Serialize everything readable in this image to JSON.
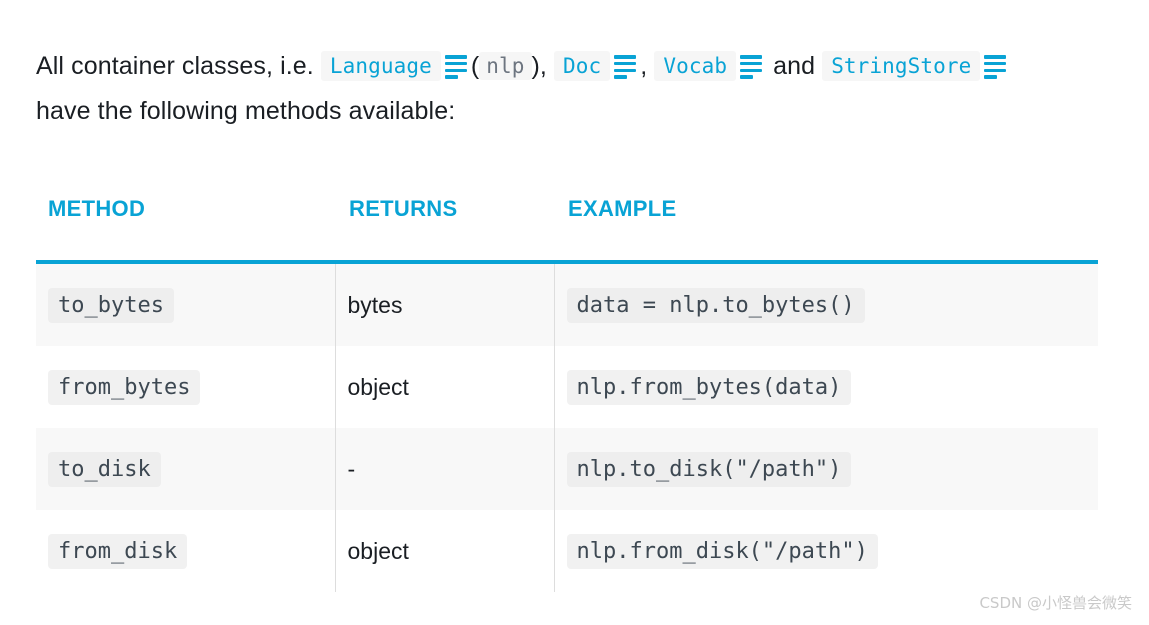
{
  "colors": {
    "accent": "#09a3d5",
    "text": "#1a1e23",
    "code_text": "#3d4852",
    "code_bg": "#eeeeee",
    "chip_bg": "#f6f6f6",
    "row_stripe": "#f8f8f8",
    "divider": "#dddddd",
    "watermark": "#c9c9c9"
  },
  "intro": {
    "part1": "All container classes, i.e.",
    "link1": "Language",
    "icon1": "doc-list-icon",
    "paren_open": "(",
    "code_nlp": "nlp",
    "paren_close": "),",
    "link2": "Doc",
    "icon2": "doc-list-icon",
    "comma": ",",
    "link3": "Vocab",
    "icon3": "doc-list-icon",
    "and": "and",
    "link4": "StringStore",
    "icon4": "doc-list-icon",
    "part2": "have the following methods available:"
  },
  "table": {
    "headers": [
      "METHOD",
      "RETURNS",
      "EXAMPLE"
    ],
    "rows": [
      {
        "method": "to_bytes",
        "returns": "bytes",
        "example": "data = nlp.to_bytes()"
      },
      {
        "method": "from_bytes",
        "returns": "object",
        "example": "nlp.from_bytes(data)"
      },
      {
        "method": "to_disk",
        "returns": "-",
        "example": "nlp.to_disk(\"/path\")"
      },
      {
        "method": "from_disk",
        "returns": "object",
        "example": "nlp.from_disk(\"/path\")"
      }
    ]
  },
  "watermark": {
    "text": "CSDN @小怪兽会微笑"
  }
}
